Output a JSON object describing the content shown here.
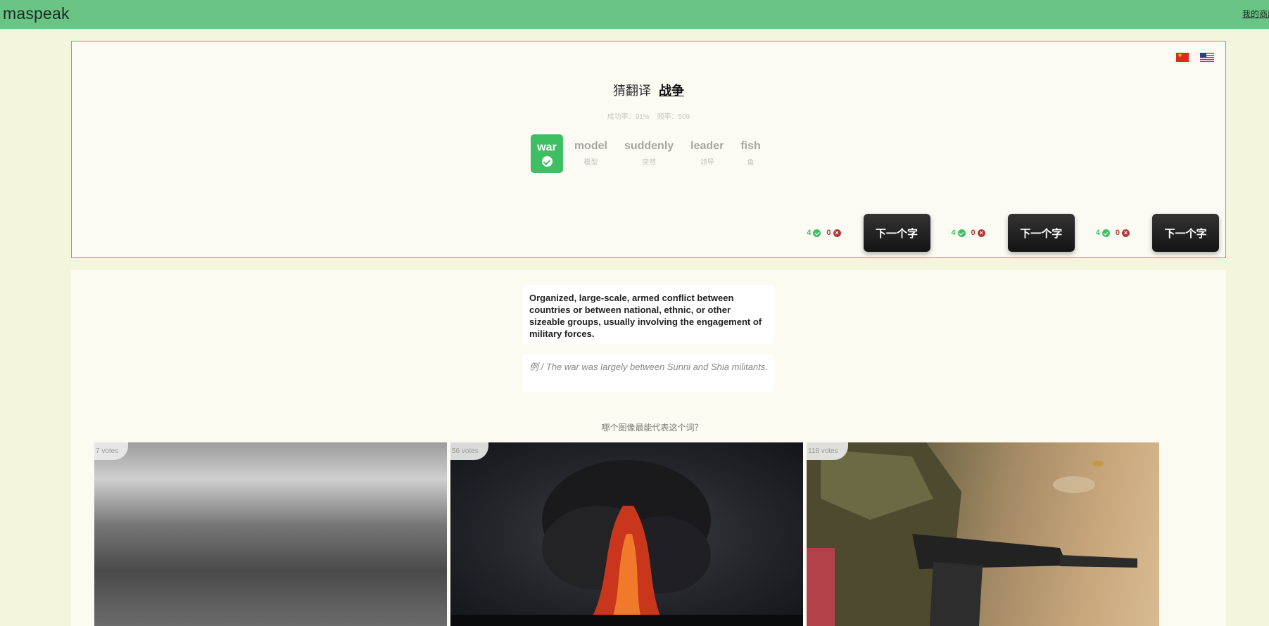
{
  "app": {
    "logo": "maspeak",
    "top_link": "我的商店"
  },
  "quiz": {
    "prompt": "猜翻译",
    "target_word": "战争",
    "stats": {
      "success_rate": "成功率：91%",
      "frequency": "频率：509"
    },
    "options": [
      {
        "en": "war",
        "zh": "",
        "selected": true
      },
      {
        "en": "model",
        "zh": "模型",
        "selected": false
      },
      {
        "en": "suddenly",
        "zh": "突然",
        "selected": false
      },
      {
        "en": "leader",
        "zh": "领导",
        "selected": false
      },
      {
        "en": "fish",
        "zh": "鱼",
        "selected": false
      }
    ],
    "action_groups": [
      {
        "correct": "4",
        "wrong": "0",
        "next_label": "下一个字"
      },
      {
        "correct": "4",
        "wrong": "0",
        "next_label": "下一个字"
      },
      {
        "correct": "4",
        "wrong": "0",
        "next_label": "下一个字"
      }
    ]
  },
  "detail": {
    "definition": "Organized, large-scale, armed conflict between countries or between national, ethnic, or other sizeable groups, usually involving the engagement of military forces.",
    "example": "例 / The war was largely between Sunni and Shia militants.",
    "question": "哪个图像最能代表这个词？",
    "images": [
      {
        "votes": "7 votes"
      },
      {
        "votes": "56 votes"
      },
      {
        "votes": "118 votes"
      }
    ]
  },
  "colors": {
    "topbar": "#69c486",
    "accent_green": "#3fbf63",
    "wrong_red": "#b23a3a",
    "page_bg": "#f4f5dd"
  },
  "icons": [
    "check-icon",
    "cross-icon",
    "china-flag-icon",
    "us-flag-icon"
  ]
}
